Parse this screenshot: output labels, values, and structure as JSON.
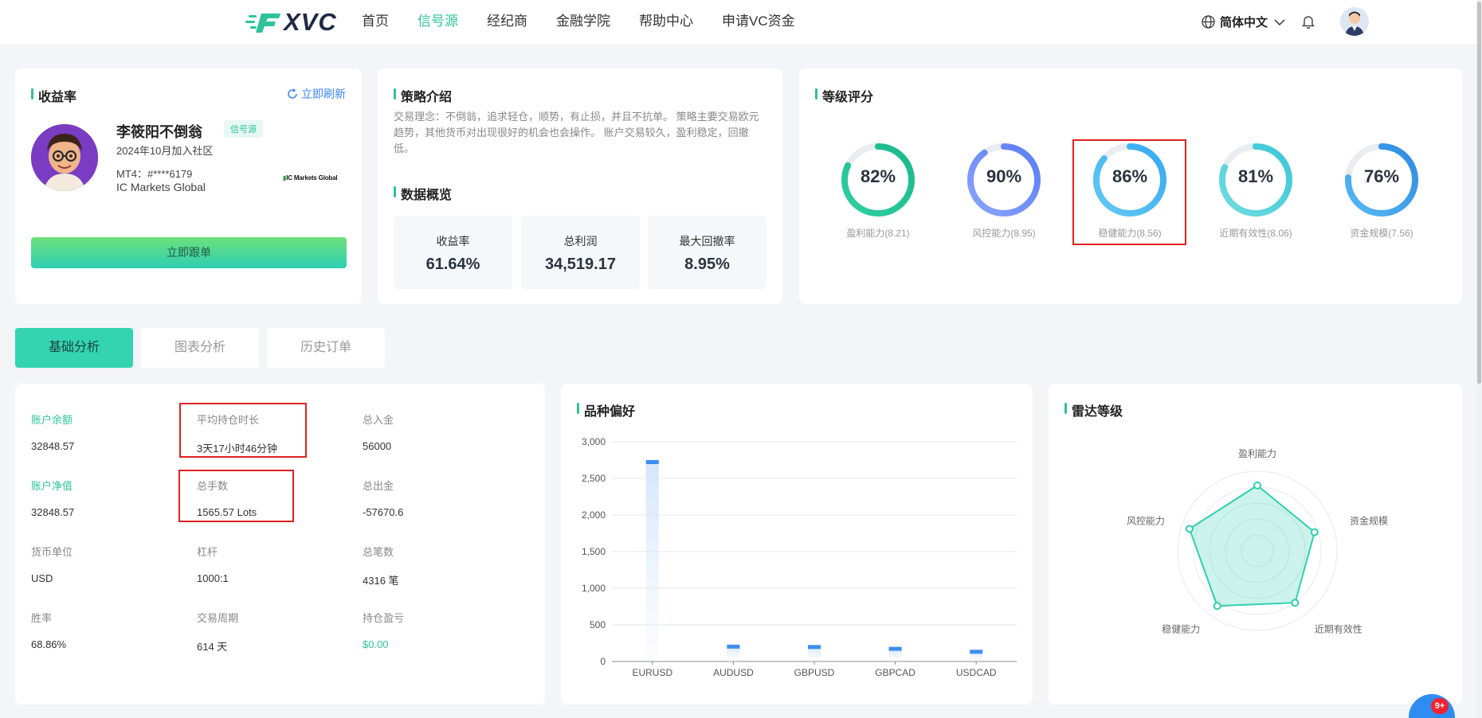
{
  "header": {
    "logo_text": "XVC",
    "nav": [
      {
        "label": "首页",
        "active": false
      },
      {
        "label": "信号源",
        "active": true
      },
      {
        "label": "经纪商",
        "active": false
      },
      {
        "label": "金融学院",
        "active": false
      },
      {
        "label": "帮助中心",
        "active": false
      },
      {
        "label": "申请VC资金",
        "active": false
      }
    ],
    "language": "简体中文"
  },
  "profile_card": {
    "title": "收益率",
    "refresh_label": "立即刷新",
    "name": "李筱阳不倒翁",
    "badge": "信号源",
    "join_date": "2024年10月加入社区",
    "mt4": "MT4：#****6179",
    "broker": "IC Markets Global",
    "broker_logo_text": "IC Markets Global",
    "follow_button": "立即跟单"
  },
  "strategy_card": {
    "title": "策略介绍",
    "description": "交易理念：不倒翁，追求轻仓，顺势，有止损，并且不抗单。 策略主要交易欧元趋势，其他货币对出现很好的机会也会操作。 账户交易较久，盈利稳定，回撤低。",
    "overview_title": "数据概览",
    "stats": [
      {
        "label": "收益率",
        "value": "61.64%"
      },
      {
        "label": "总利润",
        "value": "34,519.17"
      },
      {
        "label": "最大回撤率",
        "value": "8.95%"
      }
    ]
  },
  "grade_card": {
    "title": "等级评分",
    "gauges": [
      {
        "percent_label": "82%",
        "percent": 82,
        "label": "盈利能力(8.21)",
        "color_start": "#2ecfa0",
        "color_end": "#1ab88c"
      },
      {
        "percent_label": "90%",
        "percent": 90,
        "label": "风控能力(8.95)",
        "color_start": "#8aa4ff",
        "color_end": "#5b7cf5"
      },
      {
        "percent_label": "86%",
        "percent": 86,
        "label": "稳健能力(8.56)",
        "color_start": "#63c9f5",
        "color_end": "#36a9f0"
      },
      {
        "percent_label": "81%",
        "percent": 81,
        "label": "近期有效性(8.06)",
        "color_start": "#6fdce0",
        "color_end": "#3cc6d8"
      },
      {
        "percent_label": "76%",
        "percent": 76,
        "label": "资金规模(7.56)",
        "color_start": "#55b8f5",
        "color_end": "#2f8ae0"
      }
    ]
  },
  "tabs": [
    {
      "label": "基础分析",
      "active": true
    },
    {
      "label": "图表分析",
      "active": false
    },
    {
      "label": "历史订单",
      "active": false
    }
  ],
  "account_stats": [
    {
      "key": "账户余额",
      "value": "32848.57",
      "key_green": true
    },
    {
      "key": "平均持仓时长",
      "value": "3天17小时46分钟"
    },
    {
      "key": "总入金",
      "value": "56000"
    },
    {
      "key": "账户净值",
      "value": "32848.57",
      "key_green": true
    },
    {
      "key": "总手数",
      "value": "1565.57 Lots"
    },
    {
      "key": "总出金",
      "value": "-57670.6"
    },
    {
      "key": "货币单位",
      "value": "USD"
    },
    {
      "key": "杠杆",
      "value": "1000:1"
    },
    {
      "key": "总笔数",
      "value": "4316 笔"
    },
    {
      "key": "胜率",
      "value": "68.86%"
    },
    {
      "key": "交易周期",
      "value": "614 天"
    },
    {
      "key": "持仓盈亏",
      "value": "$0.00",
      "value_green": true
    }
  ],
  "variety_card": {
    "title": "品种偏好"
  },
  "chart_data": {
    "type": "bar",
    "title": "品种偏好",
    "categories": [
      "EURUSD",
      "AUDUSD",
      "GBPUSD",
      "GBPCAD",
      "USDCAD"
    ],
    "values": [
      2750,
      230,
      225,
      200,
      160
    ],
    "ylim": [
      0,
      3000
    ],
    "yticks": [
      "0",
      "500",
      "1,000",
      "1,500",
      "2,000",
      "2,500",
      "3,000"
    ],
    "ytick_values": [
      0,
      500,
      1000,
      1500,
      2000,
      2500,
      3000
    ],
    "grid": true,
    "bar_color": "#3d8ef0"
  },
  "radar_card": {
    "title": "雷达等级",
    "axes": [
      "盈利能力",
      "资金规模",
      "近期有效性",
      "稳健能力",
      "风控能力"
    ],
    "values": [
      8.21,
      7.56,
      8.06,
      8.56,
      8.95
    ],
    "max": 10,
    "color": "#2ecfb0"
  },
  "chat": {
    "badge": "9+"
  }
}
